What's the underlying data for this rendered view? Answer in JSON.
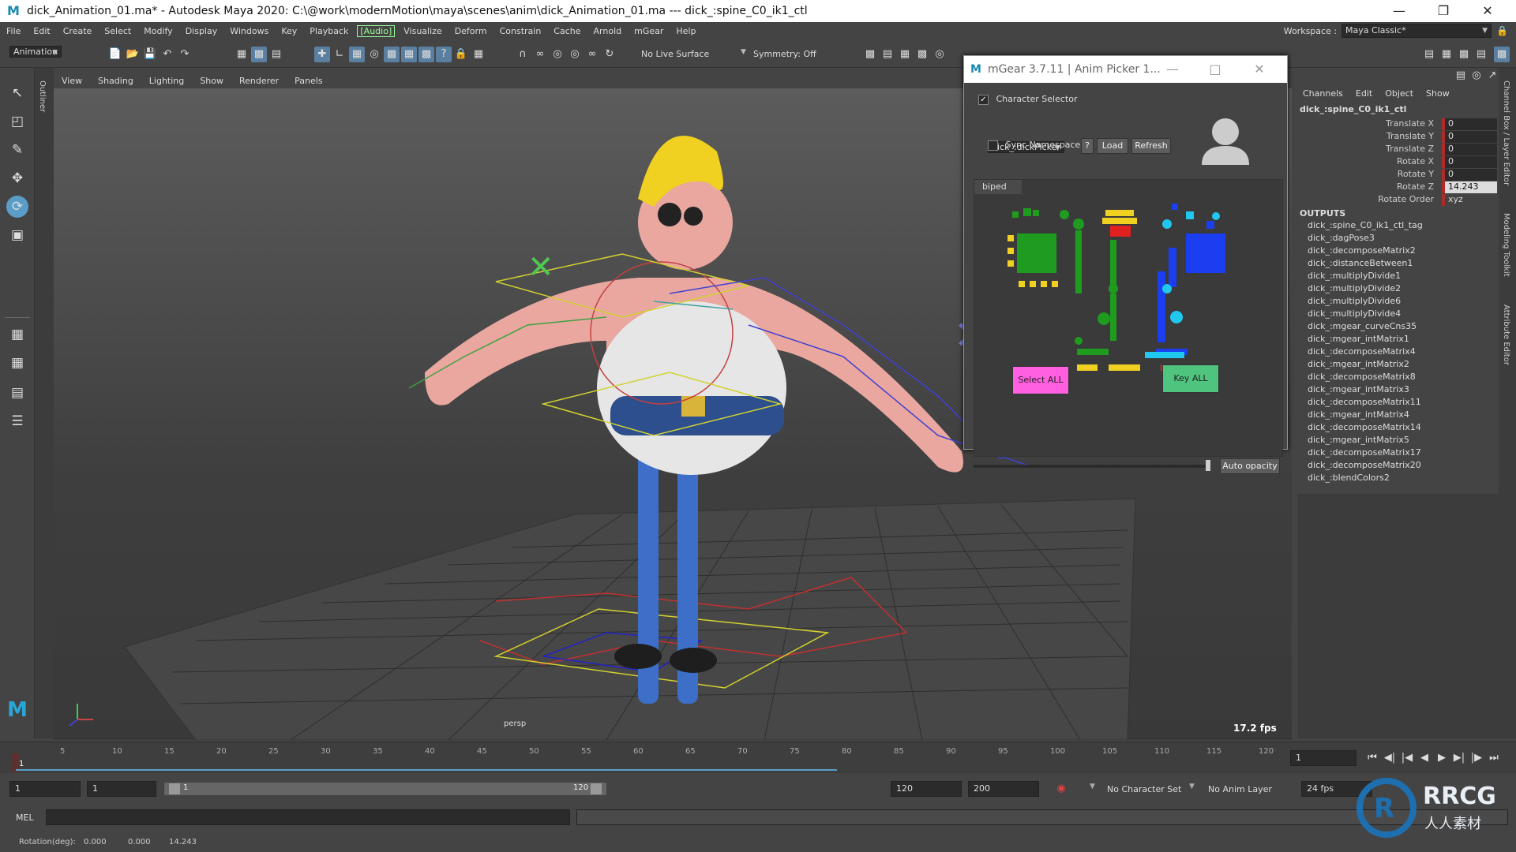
{
  "window": {
    "title": "dick_Animation_01.ma* - Autodesk Maya 2020: C:\\@work\\modernMotion\\maya\\scenes\\anim\\dick_Animation_01.ma   ---   dick_:spine_C0_ik1_ctl"
  },
  "menu": [
    "File",
    "Edit",
    "Create",
    "Select",
    "Modify",
    "Display",
    "Windows",
    "Key",
    "Playback",
    "[Audio]",
    "Visualize",
    "Deform",
    "Constrain",
    "Cache",
    "Arnold",
    "mGear",
    "Help"
  ],
  "workspace": {
    "label": "Workspace :",
    "value": "Maya Classic*"
  },
  "shelf": {
    "mode": "Animation",
    "live_surface": "No Live Surface",
    "symmetry": "Symmetry: Off"
  },
  "panel_menu": [
    "View",
    "Shading",
    "Lighting",
    "Show",
    "Renderer",
    "Panels"
  ],
  "viewport": {
    "camera": "persp",
    "fps": "17.2 fps"
  },
  "picker": {
    "title": "mGear 3.7.11 | Anim Picker 1...",
    "character_selector": "Character Selector",
    "character": "dick_:dickPicker",
    "sync_namespace": "Sync Namespace",
    "help": "?",
    "load": "Load",
    "refresh": "Refresh",
    "tab": "biped",
    "select_all": "Select ALL",
    "key_all": "Key ALL",
    "auto_opacity": "Auto opacity",
    "colors": {
      "green": "#1f9c1f",
      "yellow": "#f0d020",
      "blue": "#1a3ef0",
      "cyan": "#20c8ef",
      "red": "#e12020",
      "pink": "#ff5fe0",
      "keygreen": "#4fc47f"
    }
  },
  "channelbox": {
    "menus": [
      "Channels",
      "Edit",
      "Object",
      "Show"
    ],
    "node": "dick_:spine_C0_ik1_ctl",
    "channels": [
      {
        "name": "Translate X",
        "value": "0"
      },
      {
        "name": "Translate Y",
        "value": "0"
      },
      {
        "name": "Translate Z",
        "value": "0"
      },
      {
        "name": "Rotate X",
        "value": "0"
      },
      {
        "name": "Rotate Y",
        "value": "0"
      },
      {
        "name": "Rotate Z",
        "value": "14.243"
      },
      {
        "name": "Rotate Order",
        "value": "xyz"
      }
    ],
    "outputs_label": "OUTPUTS",
    "outputs": [
      "dick_:spine_C0_ik1_ctl_tag",
      "dick_:dagPose3",
      "dick_:decomposeMatrix2",
      "dick_:distanceBetween1",
      "dick_:multiplyDivide1",
      "dick_:multiplyDivide2",
      "dick_:multiplyDivide6",
      "dick_:multiplyDivide4",
      "dick_:mgear_curveCns35",
      "dick_:mgear_intMatrix1",
      "dick_:decomposeMatrix4",
      "dick_:mgear_intMatrix2",
      "dick_:decomposeMatrix8",
      "dick_:mgear_intMatrix3",
      "dick_:decomposeMatrix11",
      "dick_:mgear_intMatrix4",
      "dick_:decomposeMatrix14",
      "dick_:mgear_intMatrix5",
      "dick_:decomposeMatrix17",
      "dick_:decomposeMatrix20",
      "dick_:blendColors2"
    ],
    "side_tabs": [
      "Channel Box / Layer Editor",
      "Modeling Toolkit",
      "Attribute Editor"
    ]
  },
  "timeline": {
    "ticks": [
      "5",
      "10",
      "15",
      "20",
      "25",
      "30",
      "35",
      "40",
      "45",
      "50",
      "55",
      "60",
      "65",
      "70",
      "75",
      "80",
      "85",
      "90",
      "95",
      "100",
      "105",
      "110",
      "115",
      "120"
    ],
    "current_frame": "1",
    "current_frame_field": "1"
  },
  "range": {
    "start": "1",
    "start2": "1",
    "slider_start": "1",
    "slider_end": "120",
    "end": "120",
    "end2": "200",
    "char_set": "No Character Set",
    "anim_layer": "No Anim Layer",
    "fps": "24 fps"
  },
  "cmd": {
    "label": "MEL"
  },
  "help": {
    "label": "Rotation(deg):",
    "x": "0.000",
    "y": "0.000",
    "z": "14.243"
  },
  "watermark": {
    "brand": "RRCG",
    "sub": "人人素材"
  }
}
